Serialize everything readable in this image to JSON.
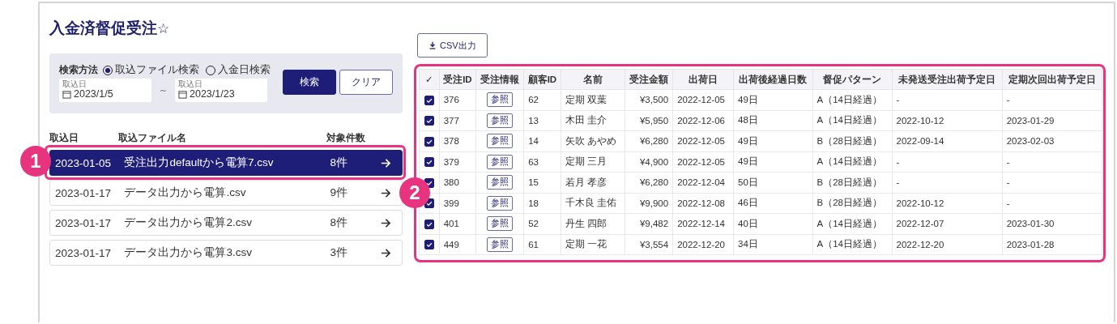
{
  "page": {
    "title": "入金済督促受注",
    "favorite": "☆"
  },
  "search": {
    "label": "検索方法",
    "options": [
      {
        "label": "取込ファイル検索",
        "selected": true
      },
      {
        "label": "入金日検索",
        "selected": false
      }
    ],
    "date_from": {
      "label": "取込日",
      "value": "2023/1/5"
    },
    "separator": "～",
    "date_to": {
      "label": "取込日",
      "value": "2023/1/23"
    },
    "buttons": [
      {
        "label": "検索",
        "kind": "primary"
      },
      {
        "label": "クリア",
        "kind": "secondary"
      }
    ]
  },
  "file_list": {
    "columns": [
      "取込日",
      "取込ファイル名",
      "対象件数"
    ],
    "rows": [
      {
        "date": "2023-01-05",
        "file": "受注出力defaultから電算7.csv",
        "count": "8件",
        "selected": true
      },
      {
        "date": "2023-01-17",
        "file": "データ出力から電算.csv",
        "count": "9件",
        "selected": false
      },
      {
        "date": "2023-01-17",
        "file": "データ出力から電算2.csv",
        "count": "8件",
        "selected": false
      },
      {
        "date": "2023-01-17",
        "file": "データ出力から電算3.csv",
        "count": "3件",
        "selected": false
      }
    ]
  },
  "csv_button": "CSV出力",
  "orders": {
    "columns": [
      "✓",
      "受注ID",
      "受注情報",
      "顧客ID",
      "名前",
      "受注金額",
      "出荷日",
      "出荷後経過日数",
      "督促パターン",
      "未発送受注出荷予定日",
      "定期次回出荷予定日"
    ],
    "rows": [
      {
        "checked": true,
        "id": "376",
        "info": "参照",
        "customer": "62",
        "name": "定期 双葉",
        "amount": "¥3,500",
        "ship": "2022-12-05",
        "elapsed": "49日",
        "pattern": "A（14日経過）",
        "unsent": "-",
        "next": "-"
      },
      {
        "checked": true,
        "id": "377",
        "info": "参照",
        "customer": "13",
        "name": "木田 圭介",
        "amount": "¥5,950",
        "ship": "2022-12-06",
        "elapsed": "48日",
        "pattern": "A（14日経過）",
        "unsent": "2022-10-12",
        "next": "2023-01-29"
      },
      {
        "checked": true,
        "id": "378",
        "info": "参照",
        "customer": "14",
        "name": "矢吹 あやめ",
        "amount": "¥6,280",
        "ship": "2022-12-05",
        "elapsed": "49日",
        "pattern": "B（28日経過）",
        "unsent": "2022-09-14",
        "next": "2023-02-03"
      },
      {
        "checked": true,
        "id": "379",
        "info": "参照",
        "customer": "63",
        "name": "定期 三月",
        "amount": "¥4,900",
        "ship": "2022-12-05",
        "elapsed": "49日",
        "pattern": "A（14日経過）",
        "unsent": "-",
        "next": "-"
      },
      {
        "checked": true,
        "id": "380",
        "info": "参照",
        "customer": "15",
        "name": "若月 孝彦",
        "amount": "¥6,280",
        "ship": "2022-12-04",
        "elapsed": "50日",
        "pattern": "B（28日経過）",
        "unsent": "-",
        "next": "-"
      },
      {
        "checked": true,
        "id": "399",
        "info": "参照",
        "customer": "18",
        "name": "千木良 圭佑",
        "amount": "¥9,900",
        "ship": "2022-12-08",
        "elapsed": "46日",
        "pattern": "B（28日経過）",
        "unsent": "2022-10-12",
        "next": "-"
      },
      {
        "checked": true,
        "id": "401",
        "info": "参照",
        "customer": "52",
        "name": "丹生 四郎",
        "amount": "¥9,482",
        "ship": "2022-12-14",
        "elapsed": "40日",
        "pattern": "A（14日経過）",
        "unsent": "2022-12-07",
        "next": "2023-01-30"
      },
      {
        "checked": true,
        "id": "449",
        "info": "参照",
        "customer": "61",
        "name": "定期 一花",
        "amount": "¥3,554",
        "ship": "2022-12-20",
        "elapsed": "34日",
        "pattern": "A（14日経過）",
        "unsent": "2022-12-20",
        "next": "2023-01-28"
      }
    ]
  },
  "callouts": [
    "1",
    "2"
  ]
}
